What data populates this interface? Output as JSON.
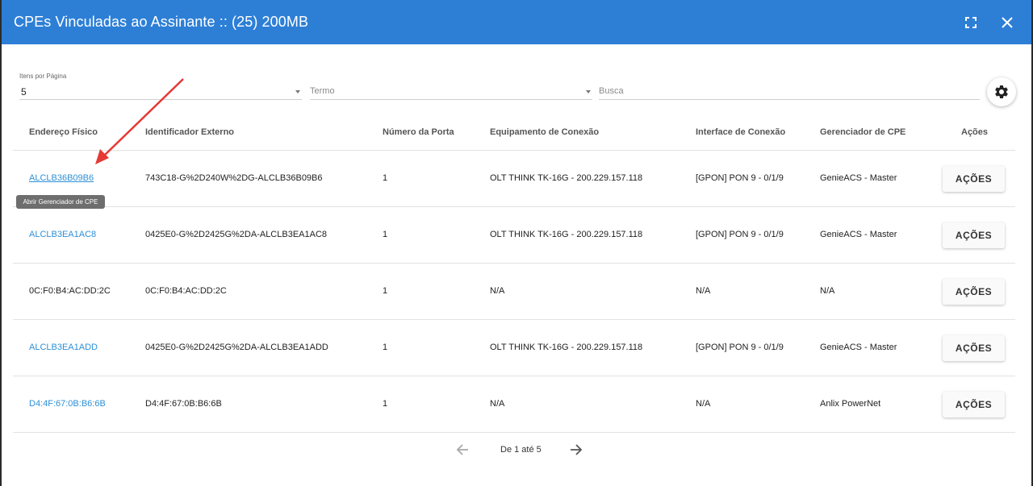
{
  "header": {
    "title": "CPEs Vinculadas ao Assinante :: (25) 200MB",
    "fullscreen_icon": "fullscreen-icon",
    "close_icon": "close-icon"
  },
  "filters": {
    "items_label": "Itens por Página",
    "items_value": "5",
    "termo_placeholder": "Termo",
    "busca_placeholder": "Busca",
    "settings_icon": "gear-icon"
  },
  "table": {
    "headers": [
      "Endereço Físico",
      "Identificador Externo",
      "Número da Porta",
      "Equipamento de Conexão",
      "Interface de Conexão",
      "Gerenciador de CPE",
      "Ações"
    ],
    "rows": [
      {
        "mac": "ALCLB36B09B6",
        "external_id": "743C18-G%2D240W%2DG-ALCLB36B09B6",
        "port": "1",
        "equipment": "OLT THINK TK-16G - 200.229.157.118",
        "interface": "[GPON] PON 9 - 0/1/9",
        "manager": "GenieACS - Master",
        "action": "AÇÕES"
      },
      {
        "mac": "ALCLB3EA1AC8",
        "external_id": "0425E0-G%2D2425G%2DA-ALCLB3EA1AC8",
        "port": "1",
        "equipment": "OLT THINK TK-16G - 200.229.157.118",
        "interface": "[GPON] PON 9 - 0/1/9",
        "manager": "GenieACS - Master",
        "action": "AÇÕES"
      },
      {
        "mac": "0C:F0:B4:AC:DD:2C",
        "external_id": "0C:F0:B4:AC:DD:2C",
        "port": "1",
        "equipment": "N/A",
        "interface": "N/A",
        "manager": "N/A",
        "action": "AÇÕES"
      },
      {
        "mac": "ALCLB3EA1ADD",
        "external_id": "0425E0-G%2D2425G%2DA-ALCLB3EA1ADD",
        "port": "1",
        "equipment": "OLT THINK TK-16G - 200.229.157.118",
        "interface": "[GPON] PON 9 - 0/1/9",
        "manager": "GenieACS - Master",
        "action": "AÇÕES"
      },
      {
        "mac": "D4:4F:67:0B:B6:6B",
        "external_id": "D4:4F:67:0B:B6:6B",
        "port": "1",
        "equipment": "N/A",
        "interface": "N/A",
        "manager": "Anlix PowerNet",
        "action": "AÇÕES"
      }
    ]
  },
  "tooltip": "Abrir Gerenciador de CPE",
  "pagination": {
    "text": "De 1 até 5",
    "prev_icon": "arrow-left-icon",
    "next_icon": "arrow-right-icon"
  },
  "annotation": {
    "color": "#e53935"
  }
}
